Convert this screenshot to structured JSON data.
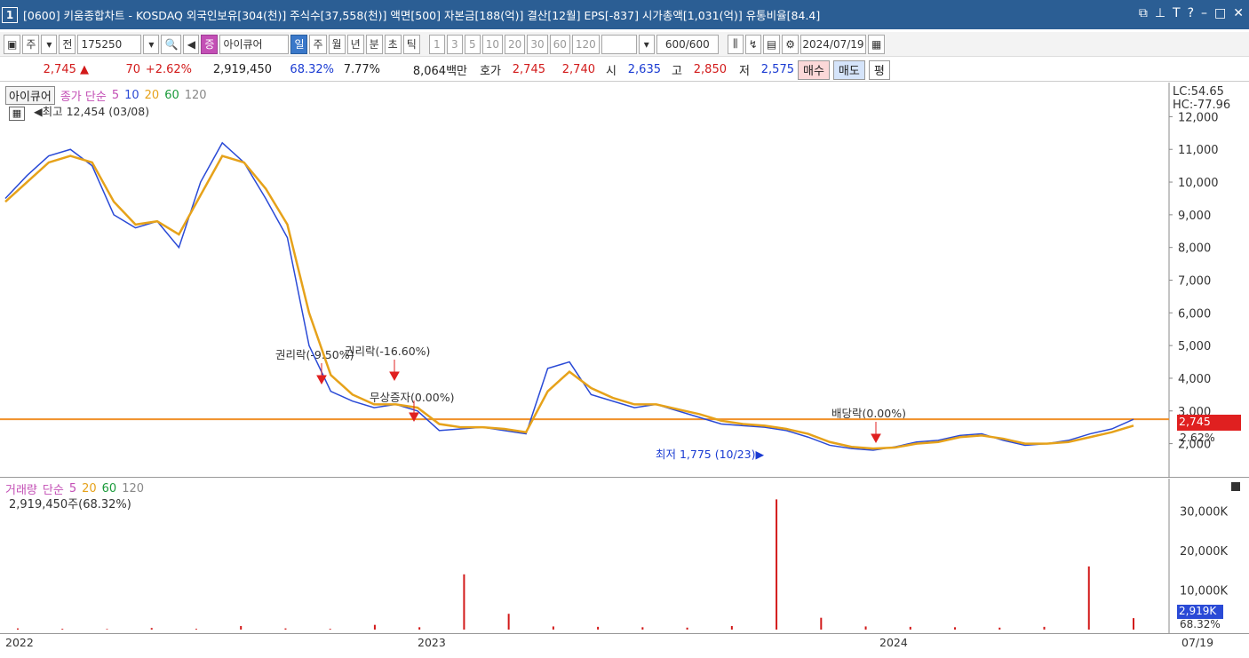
{
  "window": {
    "num": "1",
    "title": "[0600] 키움종합차트 - KOSDAQ 외국인보유[304(천)] 주식수[37,558(천)] 액면[500] 자본금[188(억)] 결산[12월] EPS[-837] 시가총액[1,031(억)] 유통비율[84.4]"
  },
  "toolbar": {
    "market": "주",
    "prev": "전",
    "code": "175250",
    "badge": "증",
    "name": "아이큐어",
    "periods": [
      "일",
      "주",
      "월",
      "년",
      "분",
      "초",
      "틱"
    ],
    "minutes": [
      "1",
      "3",
      "5",
      "10",
      "20",
      "30",
      "60",
      "120"
    ],
    "count": "600",
    "count_total": "/600",
    "date": "2024/07/19"
  },
  "info": {
    "price": "2,745",
    "change": "70",
    "rate": "+2.62%",
    "volume": "2,919,450",
    "vol_rate": "68.32%",
    "turnover": "7.77%",
    "amount": "8,064백만",
    "hoga_label": "호가",
    "ask": "2,745",
    "bid": "2,740",
    "open_label": "시",
    "open": "2,635",
    "high_label": "고",
    "high": "2,850",
    "low_label": "저",
    "low": "2,575",
    "buy": "매수",
    "sell": "매도",
    "flat": "평"
  },
  "price_panel": {
    "stock_label": "아이큐어",
    "ma_label": "종가 단순",
    "ma_periods": [
      "5",
      "10",
      "20",
      "60",
      "120"
    ],
    "max_note": "최고 12,454 (03/08)",
    "min_note": "최저 1,775 (10/23)",
    "lc": "LC:54.65",
    "hc": "HC:-77.96",
    "y_ticks": [
      "12,000",
      "11,000",
      "10,000",
      "9,000",
      "8,000",
      "7,000",
      "6,000",
      "5,000",
      "4,000",
      "3,000",
      "2,000"
    ],
    "current": "2,745",
    "current_rate": "2.62%",
    "events": [
      {
        "label": "권리락(-9.50%)"
      },
      {
        "label": "권리락(-16.60%)"
      },
      {
        "label": "무상증자(0.00%)"
      },
      {
        "label": "배당락(0.00%)"
      }
    ]
  },
  "volume_panel": {
    "label": "거래량",
    "ma_label": "단순",
    "ma_periods": [
      "5",
      "20",
      "60",
      "120"
    ],
    "value_note": "2,919,450주(68.32%)",
    "y_ticks": [
      "30,000K",
      "20,000K",
      "10,000K"
    ],
    "current": "2,919K",
    "current_rate": "68.32%"
  },
  "dates": {
    "ticks": [
      "2022",
      "2023",
      "2024"
    ],
    "last": "07/19"
  },
  "chart_data": {
    "type": "line",
    "title": "아이큐어",
    "series": [
      {
        "name": "종가",
        "values": [
          9500,
          10200,
          10800,
          11000,
          10500,
          9000,
          8600,
          8800,
          8000,
          10000,
          11200,
          10600,
          9500,
          8300,
          5000,
          3600,
          3300,
          3100,
          3200,
          3000,
          2400,
          2450,
          2500,
          2400,
          2300,
          4300,
          4500,
          3500,
          3300,
          3100,
          3200,
          3000,
          2800,
          2600,
          2550,
          2500,
          2400,
          2200,
          1950,
          1850,
          1800,
          1900,
          2050,
          2100,
          2250,
          2300,
          2100,
          1950,
          2000,
          2100,
          2300,
          2450,
          2745
        ]
      },
      {
        "name": "20",
        "values": [
          9400,
          10000,
          10600,
          10800,
          10600,
          9400,
          8700,
          8800,
          8400,
          9600,
          10800,
          10600,
          9800,
          8700,
          6000,
          4100,
          3500,
          3200,
          3200,
          3100,
          2600,
          2500,
          2500,
          2450,
          2350,
          3600,
          4200,
          3700,
          3400,
          3200,
          3200,
          3050,
          2900,
          2700,
          2600,
          2550,
          2450,
          2300,
          2050,
          1900,
          1850,
          1880,
          2000,
          2050,
          2200,
          2250,
          2150,
          2000,
          2000,
          2050,
          2200,
          2350,
          2550
        ]
      }
    ],
    "volume": [
      300,
      200,
      150,
      400,
      200,
      900,
      300,
      200,
      1200,
      600,
      14000,
      4000,
      800,
      700,
      600,
      500,
      900,
      33000,
      3000,
      800,
      700,
      600,
      500,
      700,
      16000,
      2900
    ]
  }
}
